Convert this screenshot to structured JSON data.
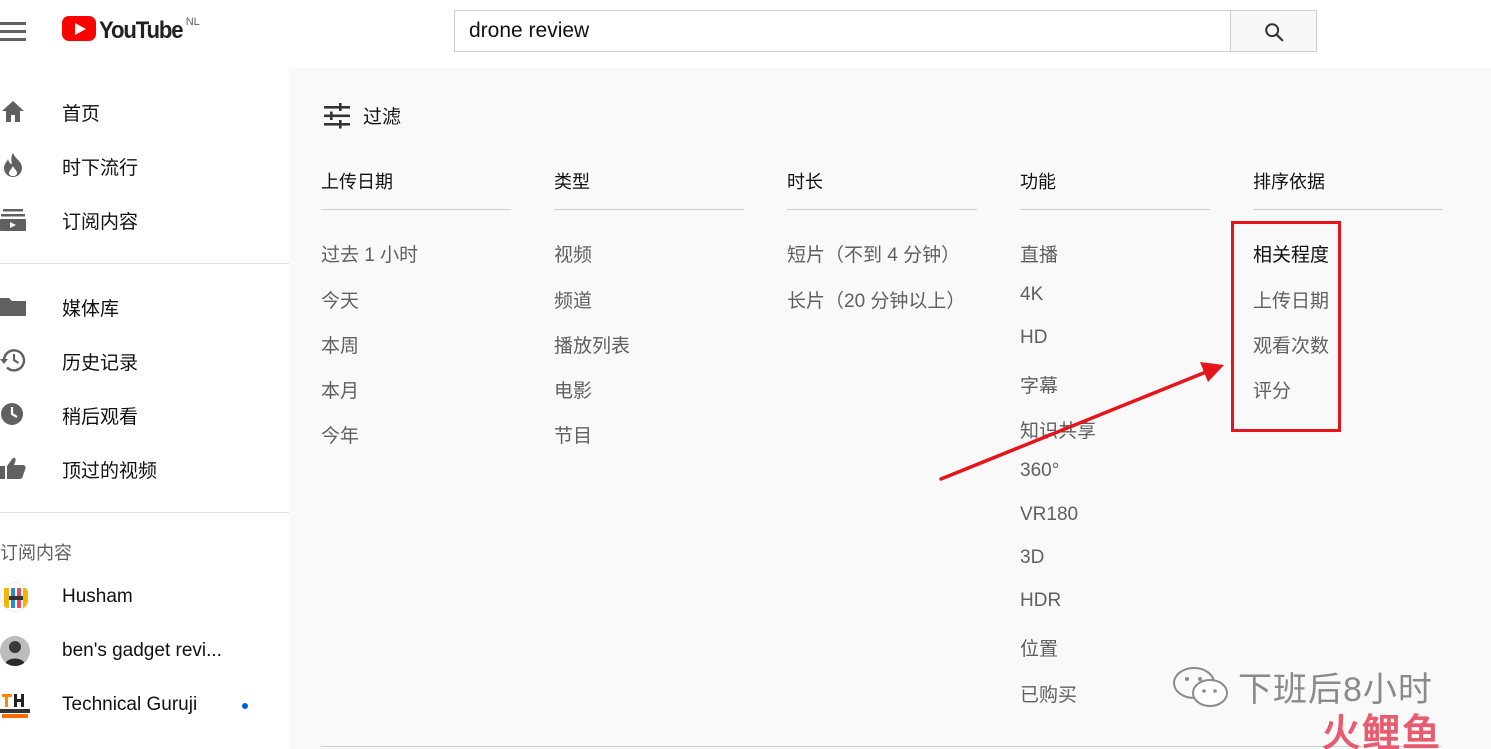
{
  "header": {
    "logo_text": "YouTube",
    "logo_country": "NL",
    "search_value": "drone review",
    "search_placeholder": "搜索"
  },
  "sidebar": {
    "main_items": [
      {
        "label": "首页",
        "icon": "home-icon"
      },
      {
        "label": "时下流行",
        "icon": "trending-icon"
      },
      {
        "label": "订阅内容",
        "icon": "subscriptions-icon"
      }
    ],
    "library_items": [
      {
        "label": "媒体库",
        "icon": "folder-icon"
      },
      {
        "label": "历史记录",
        "icon": "history-icon"
      },
      {
        "label": "稍后观看",
        "icon": "clock-icon"
      },
      {
        "label": "顶过的视频",
        "icon": "thumbs-up-icon"
      }
    ],
    "subscriptions_title": "订阅内容",
    "subscriptions": [
      {
        "name": "Husham",
        "new": false
      },
      {
        "name": "ben's gadget revi...",
        "new": false
      },
      {
        "name": "Technical Guruji",
        "new": true
      }
    ]
  },
  "filters": {
    "toggle_label": "过滤",
    "columns": [
      {
        "header": "上传日期",
        "options": [
          "过去 1 小时",
          "今天",
          "本周",
          "本月",
          "今年"
        ]
      },
      {
        "header": "类型",
        "options": [
          "视频",
          "频道",
          "播放列表",
          "电影",
          "节目"
        ]
      },
      {
        "header": "时长",
        "options": [
          "短片（不到 4 分钟）",
          "长片（20 分钟以上）"
        ]
      },
      {
        "header": "功能",
        "options": [
          "直播",
          "4K",
          "HD",
          "字幕",
          "知识共享",
          "360°",
          "VR180",
          "3D",
          "HDR",
          "位置",
          "已购买"
        ]
      },
      {
        "header": "排序依据",
        "options": [
          "相关程度",
          "上传日期",
          "观看次数",
          "评分"
        ],
        "active_index": 0
      }
    ]
  },
  "watermark": {
    "line1": "下班后8小时",
    "line2": "火鲤鱼"
  },
  "colors": {
    "accent_red": "#e8141c",
    "youtube_red": "#ff0000",
    "new_dot": "#065fd4"
  }
}
